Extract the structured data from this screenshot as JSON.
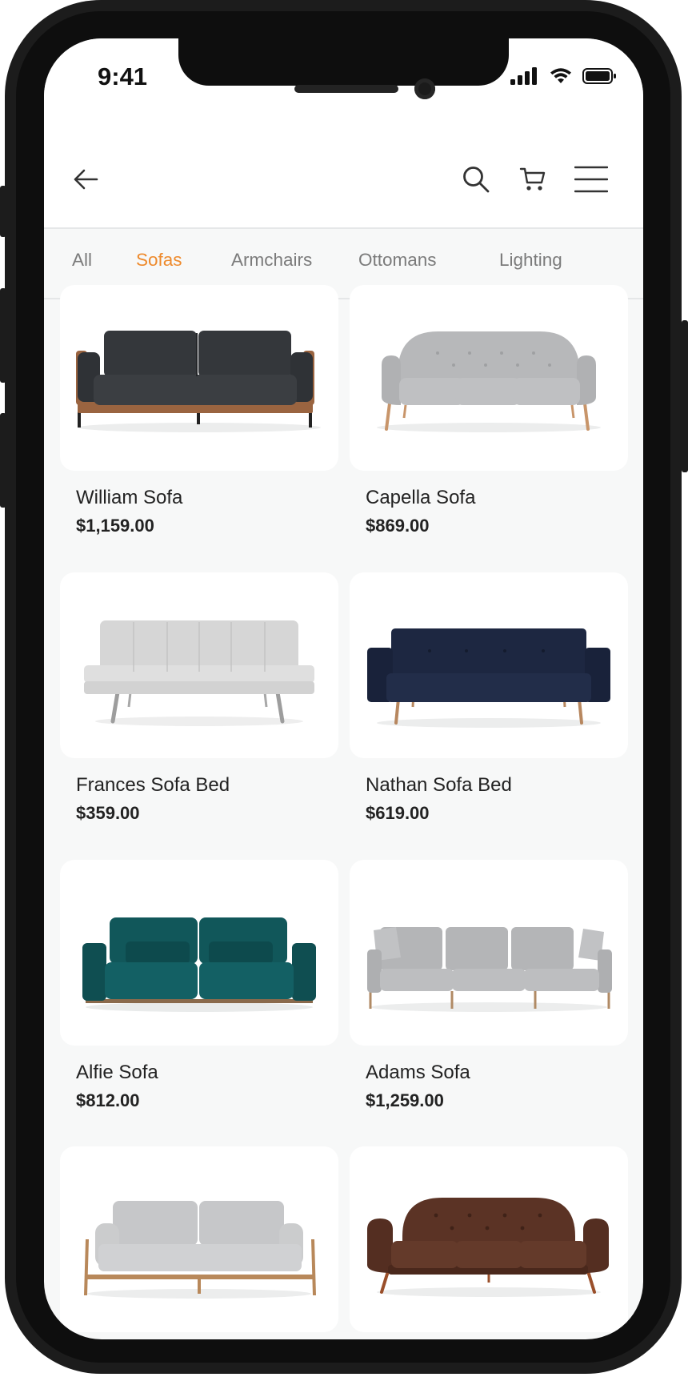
{
  "status": {
    "time": "9:41"
  },
  "header": {
    "back_icon": "arrow-left-icon",
    "search_icon": "search-icon",
    "cart_icon": "cart-icon",
    "menu_icon": "menu-icon"
  },
  "tabs": [
    {
      "label": "All",
      "active": false
    },
    {
      "label": "Sofas",
      "active": true
    },
    {
      "label": "Armchairs",
      "active": false
    },
    {
      "label": "Ottomans",
      "active": false
    },
    {
      "label": "Lighting",
      "active": false
    }
  ],
  "colors": {
    "accent": "#ee8a2c",
    "background": "#f7f8f8",
    "card": "#ffffff"
  },
  "products": [
    {
      "name": "William Sofa",
      "price": "$1,159.00",
      "image": "charcoal-sofa-wood-frame"
    },
    {
      "name": "Capella Sofa",
      "price": "$869.00",
      "image": "light-grey-tufted-sofa"
    },
    {
      "name": "Frances Sofa Bed",
      "price": "$359.00",
      "image": "white-tufted-sofa-bed"
    },
    {
      "name": "Nathan Sofa Bed",
      "price": "$619.00",
      "image": "navy-sofa-bed"
    },
    {
      "name": "Alfie Sofa",
      "price": "$812.00",
      "image": "teal-velvet-sofa"
    },
    {
      "name": "Adams Sofa",
      "price": "$1,259.00",
      "image": "grey-three-seat-sofa"
    },
    {
      "name": "",
      "price": "",
      "image": "grey-sofa-wood-frame"
    },
    {
      "name": "",
      "price": "",
      "image": "brown-leather-sofa"
    }
  ]
}
